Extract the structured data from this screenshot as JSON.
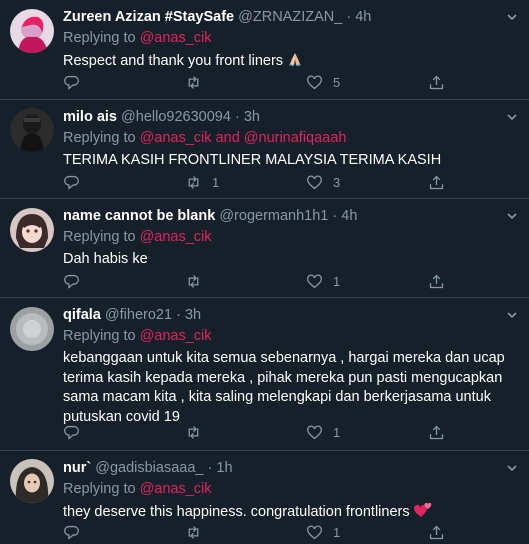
{
  "colors": {
    "background": "#15202b",
    "divider": "#38444d",
    "muted": "#8899a6",
    "mention": "#e0245e"
  },
  "tweets": [
    {
      "name": "Zureen Azizan #StaySafe",
      "handle": "@ZRNAZIZAN_",
      "dot": "·",
      "time": "4h",
      "replying_prefix": "Replying to ",
      "mentions": [
        "@anas_cik"
      ],
      "text": "Respect and thank you front liners",
      "text_emoji": "folded-hands",
      "replies": "",
      "retweets": "",
      "likes": "5",
      "avatar_icon": "avatar-pink-icon"
    },
    {
      "name": "milo ais",
      "handle": "@hello92630094",
      "dot": "·",
      "time": "3h",
      "replying_prefix": "Replying to ",
      "mentions": [
        "@anas_cik",
        "@nurinafiqaaah"
      ],
      "mention_joiner": " and ",
      "text": "TERIMA KASIH FRONTLINER MALAYSIA TERIMA KASIH",
      "replies": "",
      "retweets": "1",
      "likes": "3",
      "avatar_icon": "avatar-dark-icon"
    },
    {
      "name": "name cannot be blank",
      "handle": "@rogermanh1h1",
      "dot": "·",
      "time": "4h",
      "replying_prefix": "Replying to ",
      "mentions": [
        "@anas_cik"
      ],
      "text": "Dah habis ke",
      "replies": "",
      "retweets": "",
      "likes": "1",
      "avatar_icon": "avatar-anime-icon"
    },
    {
      "name": "qifala",
      "handle": "@fihero21",
      "dot": "·",
      "time": "3h",
      "replying_prefix": "Replying to ",
      "mentions": [
        "@anas_cik"
      ],
      "text_lines": [
        "kebanggaan untuk kita semua sebenarnya , hargai mereka dan ucap",
        "terima kasih kepada mereka , pihak mereka pun pasti mengucapkan",
        "sama macam kita , kita saling melengkapi dan berkerjasama untuk",
        "putuskan covid 19"
      ],
      "replies": "",
      "retweets": "",
      "likes": "1",
      "avatar_icon": "avatar-grey-icon"
    },
    {
      "name": "nur`",
      "handle": "@gadisbiasaaa_",
      "dot": "·",
      "time": "1h",
      "replying_prefix": "Replying to ",
      "mentions": [
        "@anas_cik"
      ],
      "text": "they deserve this happiness. congratulation frontliners",
      "text_emoji": "two-hearts",
      "replies": "",
      "retweets": "",
      "likes": "1",
      "avatar_icon": "avatar-hijab-icon"
    }
  ]
}
